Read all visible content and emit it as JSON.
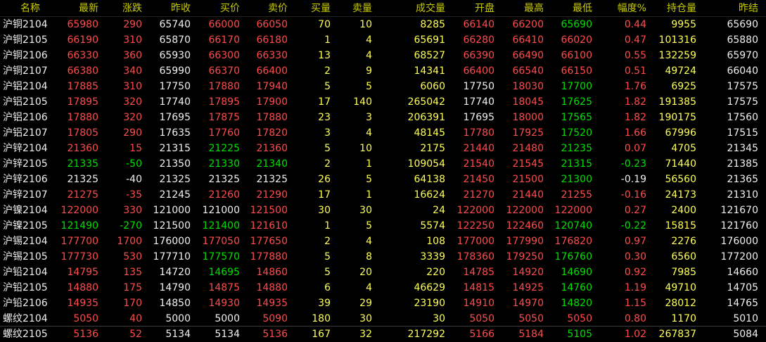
{
  "headers": [
    "名称",
    "最新",
    "涨跌",
    "昨收",
    "买价",
    "卖价",
    "买量",
    "卖量",
    "成交量",
    "开盘",
    "最高",
    "最低",
    "幅度%",
    "持仓量",
    "昨结"
  ],
  "colors": {
    "up": "#ff4b4b",
    "down": "#00e000",
    "neutral": "#f0f0f0",
    "yellow": "#ffff55",
    "header": "#c9cc00"
  },
  "rows": [
    [
      "沪铜2104",
      "65980",
      "290",
      "65740",
      "66000",
      "66050",
      "70",
      "10",
      "8285",
      "66140",
      "66200",
      "65690",
      "0.44",
      "9955",
      "65690"
    ],
    [
      "沪铜2105",
      "66190",
      "310",
      "65870",
      "66170",
      "66180",
      "1",
      "4",
      "65691",
      "66280",
      "66410",
      "66020",
      "0.47",
      "101316",
      "65880"
    ],
    [
      "沪铜2106",
      "66330",
      "360",
      "65930",
      "66300",
      "66330",
      "13",
      "4",
      "68527",
      "66390",
      "66490",
      "66100",
      "0.55",
      "132259",
      "65970"
    ],
    [
      "沪铜2107",
      "66380",
      "340",
      "65990",
      "66370",
      "66400",
      "2",
      "9",
      "14341",
      "66400",
      "66540",
      "66150",
      "0.51",
      "49724",
      "66040"
    ],
    [
      "沪铝2104",
      "17885",
      "310",
      "17750",
      "17880",
      "17940",
      "5",
      "5",
      "6060",
      "17750",
      "18030",
      "17700",
      "1.76",
      "6925",
      "17575"
    ],
    [
      "沪铝2105",
      "17895",
      "320",
      "17740",
      "17895",
      "17900",
      "17",
      "140",
      "265042",
      "17740",
      "18045",
      "17625",
      "1.82",
      "191385",
      "17575"
    ],
    [
      "沪铝2106",
      "17880",
      "320",
      "17695",
      "17875",
      "17880",
      "23",
      "3",
      "206391",
      "17695",
      "18000",
      "17565",
      "1.82",
      "190175",
      "17560"
    ],
    [
      "沪铝2107",
      "17805",
      "290",
      "17635",
      "17760",
      "17820",
      "3",
      "4",
      "48145",
      "17780",
      "17925",
      "17520",
      "1.66",
      "67996",
      "17515"
    ],
    [
      "沪锌2104",
      "21360",
      "15",
      "21315",
      "21225",
      "21360",
      "5",
      "10",
      "2175",
      "21440",
      "21480",
      "21235",
      "0.07",
      "4705",
      "21345"
    ],
    [
      "沪锌2105",
      "21335",
      "-50",
      "21350",
      "21330",
      "21340",
      "2",
      "1",
      "109054",
      "21540",
      "21545",
      "21315",
      "-0.23",
      "71440",
      "21385"
    ],
    [
      "沪锌2106",
      "21325",
      "-40",
      "21325",
      "21325",
      "21325",
      "26",
      "5",
      "64138",
      "21450",
      "21500",
      "21300",
      "-0.19",
      "56560",
      "21365"
    ],
    [
      "沪锌2107",
      "21275",
      "-35",
      "21245",
      "21260",
      "21290",
      "17",
      "1",
      "16624",
      "21270",
      "21440",
      "21255",
      "-0.16",
      "24173",
      "21310"
    ],
    [
      "沪镍2104",
      "122000",
      "330",
      "121000",
      "121000",
      "121500",
      "30",
      "30",
      "24",
      "122000",
      "122000",
      "122000",
      "0.27",
      "2400",
      "121670"
    ],
    [
      "沪镍2105",
      "121490",
      "-270",
      "121500",
      "121400",
      "121610",
      "1",
      "5",
      "5574",
      "122250",
      "122460",
      "120740",
      "-0.22",
      "15815",
      "121760"
    ],
    [
      "沪锡2104",
      "177700",
      "1700",
      "176000",
      "177050",
      "177650",
      "2",
      "4",
      "108",
      "177000",
      "177990",
      "176820",
      "0.97",
      "2276",
      "176000"
    ],
    [
      "沪锡2105",
      "177730",
      "530",
      "177710",
      "177570",
      "177880",
      "5",
      "8",
      "3339",
      "178360",
      "179250",
      "176760",
      "0.30",
      "6560",
      "177200"
    ],
    [
      "沪铅2104",
      "14795",
      "135",
      "14720",
      "14695",
      "14860",
      "5",
      "20",
      "220",
      "14785",
      "14920",
      "14690",
      "0.92",
      "7985",
      "14660"
    ],
    [
      "沪铅2105",
      "14880",
      "175",
      "14790",
      "14875",
      "14880",
      "6",
      "4",
      "46629",
      "14815",
      "14925",
      "14760",
      "1.19",
      "49710",
      "14705"
    ],
    [
      "沪铅2106",
      "14935",
      "170",
      "14850",
      "14930",
      "14935",
      "39",
      "29",
      "23190",
      "14910",
      "14970",
      "14820",
      "1.15",
      "28012",
      "14765"
    ],
    [
      "螺纹2104",
      "5050",
      "40",
      "5000",
      "5000",
      "5090",
      "180",
      "30",
      "30",
      "5050",
      "5050",
      "5050",
      "0.80",
      "1170",
      "5010"
    ],
    [
      "螺纹2105",
      "5136",
      "52",
      "5134",
      "5134",
      "5136",
      "167",
      "32",
      "217292",
      "5166",
      "5184",
      "5105",
      "1.02",
      "267837",
      "5084"
    ]
  ]
}
